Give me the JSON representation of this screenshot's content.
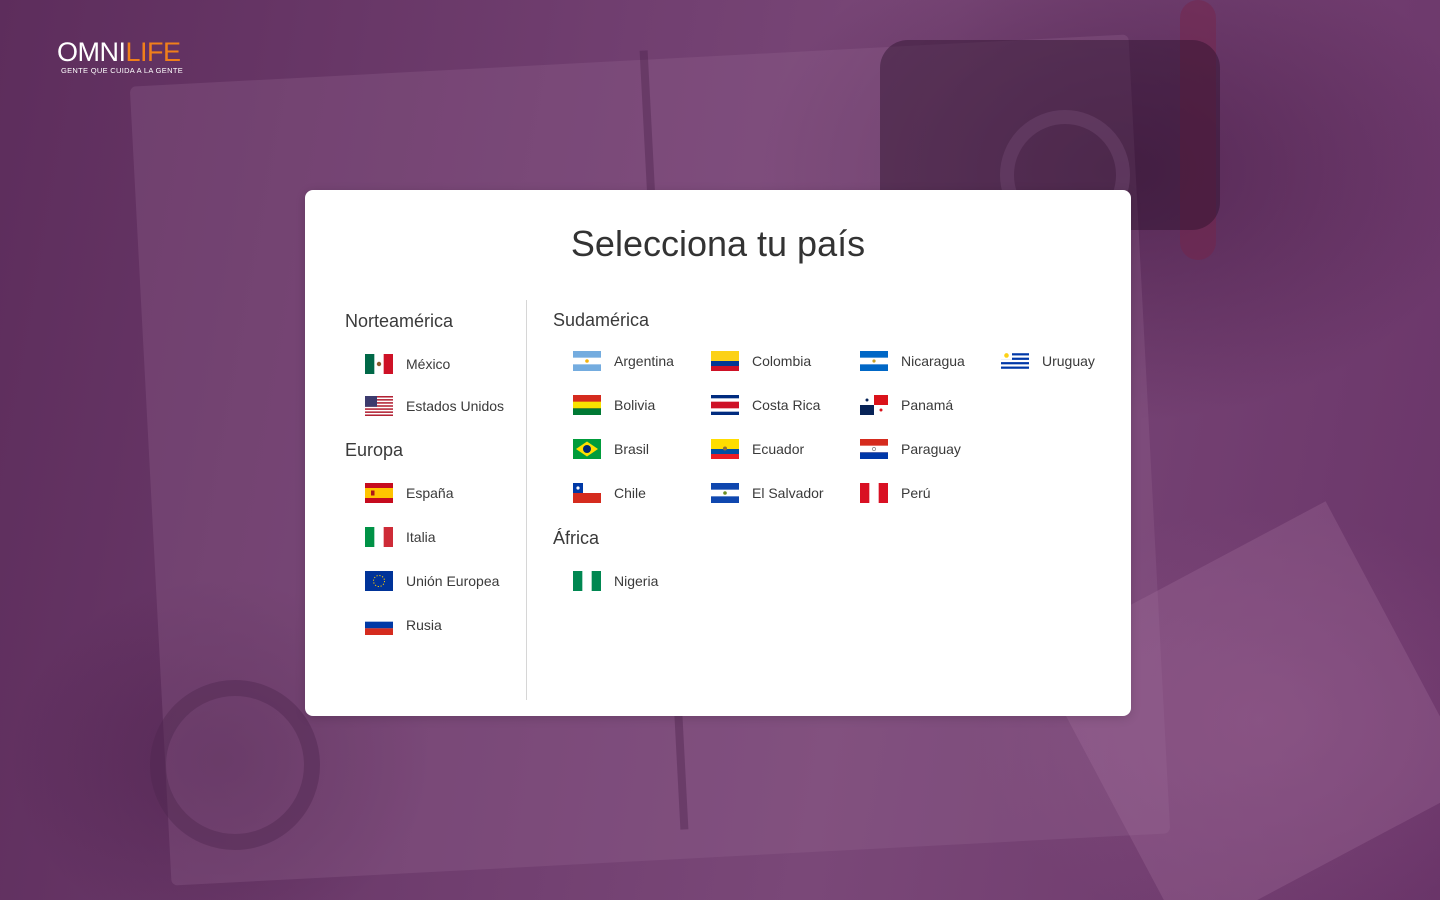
{
  "brand": {
    "name_part1": "OMNI",
    "name_part2": "LIFE",
    "tagline": "GENTE QUE CUIDA A LA GENTE"
  },
  "title": "Selecciona tu país",
  "regions": {
    "norteamerica": {
      "title": "Norteamérica",
      "countries": [
        "México",
        "Estados Unidos"
      ]
    },
    "europa": {
      "title": "Europa",
      "countries": [
        "España",
        "Italia",
        "Unión Europea",
        "Rusia"
      ]
    },
    "sudamerica": {
      "title": "Sudamérica",
      "countries": [
        "Argentina",
        "Colombia",
        "Nicaragua",
        "Uruguay",
        "Bolivia",
        "Costa Rica",
        "Panamá",
        "Brasil",
        "Ecuador",
        "Paraguay",
        "Chile",
        "El Salvador",
        "Perú"
      ]
    },
    "africa": {
      "title": "África",
      "countries": [
        "Nigeria"
      ]
    }
  },
  "colors": {
    "background": "#6d3a6b",
    "brand_orange": "#f07f1b",
    "text": "#3a3a3a"
  }
}
